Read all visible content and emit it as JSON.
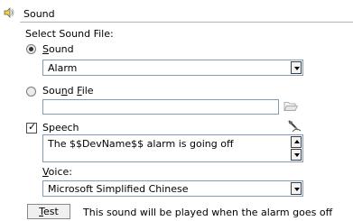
{
  "header": {
    "title": "Sound",
    "icon": "speaker-icon"
  },
  "select_sound_file_label": "Select Sound File:",
  "sound_option": {
    "prefix": "",
    "underlined": "S",
    "suffix": "ound",
    "checked": true
  },
  "sound_dropdown": {
    "value": "Alarm"
  },
  "sound_file_option": {
    "prefix": "Sou",
    "underlined": "n",
    "middle": "d ",
    "underlined2": "F",
    "suffix": "ile",
    "checked": false
  },
  "sound_file_input": {
    "value": ""
  },
  "speech": {
    "label": "Speech",
    "checked": true,
    "check_glyph": "✓",
    "text": "The $$DevName$$ alarm is going off"
  },
  "voice": {
    "prefix": "",
    "underlined": "V",
    "suffix": "oice:",
    "value": "Microsoft Simplified Chinese"
  },
  "test_button": {
    "underlined": "T",
    "suffix": "est"
  },
  "test_note": "This sound will be played when the alarm goes off",
  "icons": {
    "header": "speaker-icon",
    "browse": "folder-icon",
    "speech": "speech-test-icon"
  }
}
